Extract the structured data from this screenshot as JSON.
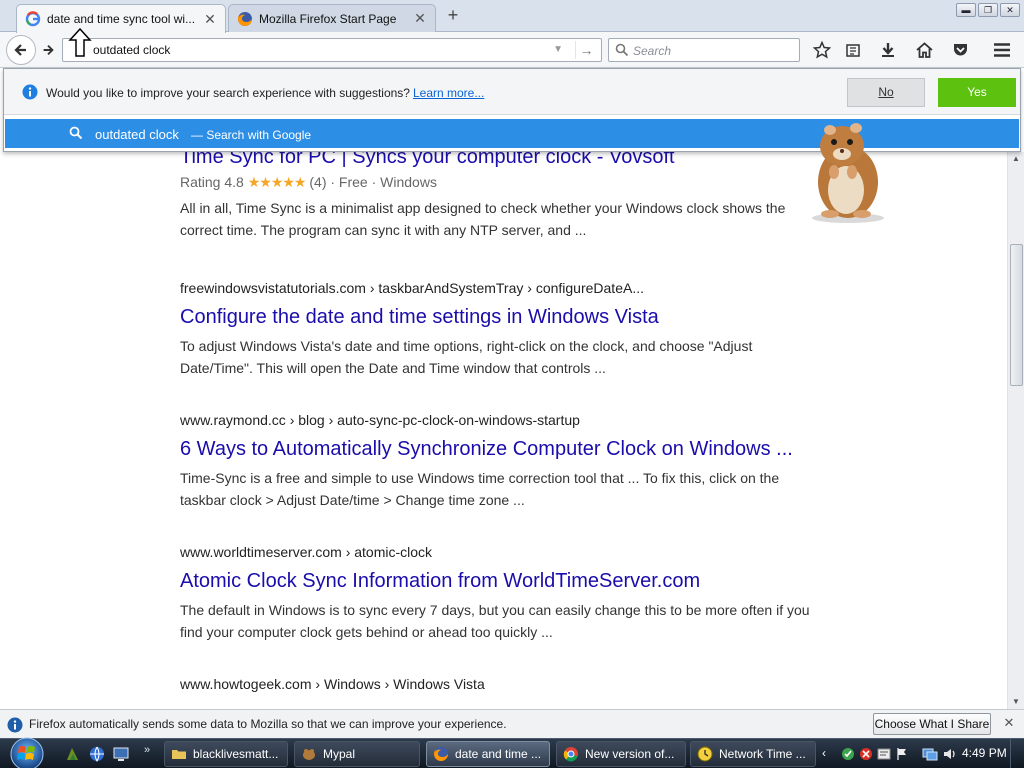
{
  "browser": {
    "tabs": [
      {
        "title": "date and time sync tool wi...",
        "favicon": "google-g-icon",
        "active": true
      },
      {
        "title": "Mozilla Firefox Start Page",
        "favicon": "firefox-icon",
        "active": false
      }
    ],
    "new_tab_symbol": "+",
    "window_controls": {
      "minimize": "▬",
      "restore": "❐",
      "close": "✕"
    }
  },
  "navbar": {
    "url_value": "outdated clock",
    "search_placeholder": "Search"
  },
  "suggestions_prompt": {
    "question": "Would you like to improve your search experience with suggestions?",
    "learn_more": "Learn more...",
    "no_label": "No",
    "yes_label": "Yes",
    "yes_color": "#5cc10f"
  },
  "search_suggestion": {
    "query": "outdated clock",
    "engine_text": "— Search with Google",
    "row_color": "#2d8ee6"
  },
  "results": [
    {
      "title": "Time Sync for PC | Syncs your computer clock - Vovsoft",
      "rating_text": "Rating 4.8",
      "stars": "★★★★★",
      "rating_meta": "(4) · Free · Windows",
      "snippet": "All in all, Time Sync is a minimalist app designed to check whether your Windows clock shows the correct time. The program can sync it with any NTP server, and ..."
    },
    {
      "url": "freewindowsvistatutorials.com › taskbarAndSystemTray › configureDateA...",
      "title": "Configure the date and time settings in Windows Vista",
      "snippet": "To adjust Windows Vista's date and time options, right-click on the clock, and choose \"Adjust Date/Time\". This will open the Date and Time window that controls ..."
    },
    {
      "url": "www.raymond.cc › blog › auto-sync-pc-clock-on-windows-startup",
      "title": "6 Ways to Automatically Synchronize Computer Clock on Windows ...",
      "snippet": "Time-Sync is a free and simple to use Windows time correction tool that ... To fix this, click on the taskbar clock > Adjust Date/time > Change time zone ..."
    },
    {
      "url": "www.worldtimeserver.com › atomic-clock",
      "title": "Atomic Clock Sync Information from WorldTimeServer.com",
      "snippet": "The default in Windows is to sync every 7 days, but you can easily change this to be more often if you find your computer clock gets behind or ahead too quickly ..."
    },
    {
      "url": "www.howtogeek.com › Windows › Windows Vista"
    }
  ],
  "notification": {
    "text": "Firefox automatically sends some data to Mozilla so that we can improve your experience.",
    "button": "Choose What I Share",
    "close": "✕"
  },
  "taskbar": {
    "quicklaunch_more": "»",
    "tasks": [
      {
        "label": "blacklivesmatt...",
        "icon": "folder-icon"
      },
      {
        "label": "Mypal",
        "icon": "mypal-icon"
      },
      {
        "label": "date and time ...",
        "icon": "firefox-icon",
        "active": true
      },
      {
        "label": "New version of...",
        "icon": "chrome-icon"
      },
      {
        "label": "Network Time ...",
        "icon": "clock-app-icon"
      }
    ],
    "tray_expand": "‹",
    "clock": "4:49 PM"
  }
}
